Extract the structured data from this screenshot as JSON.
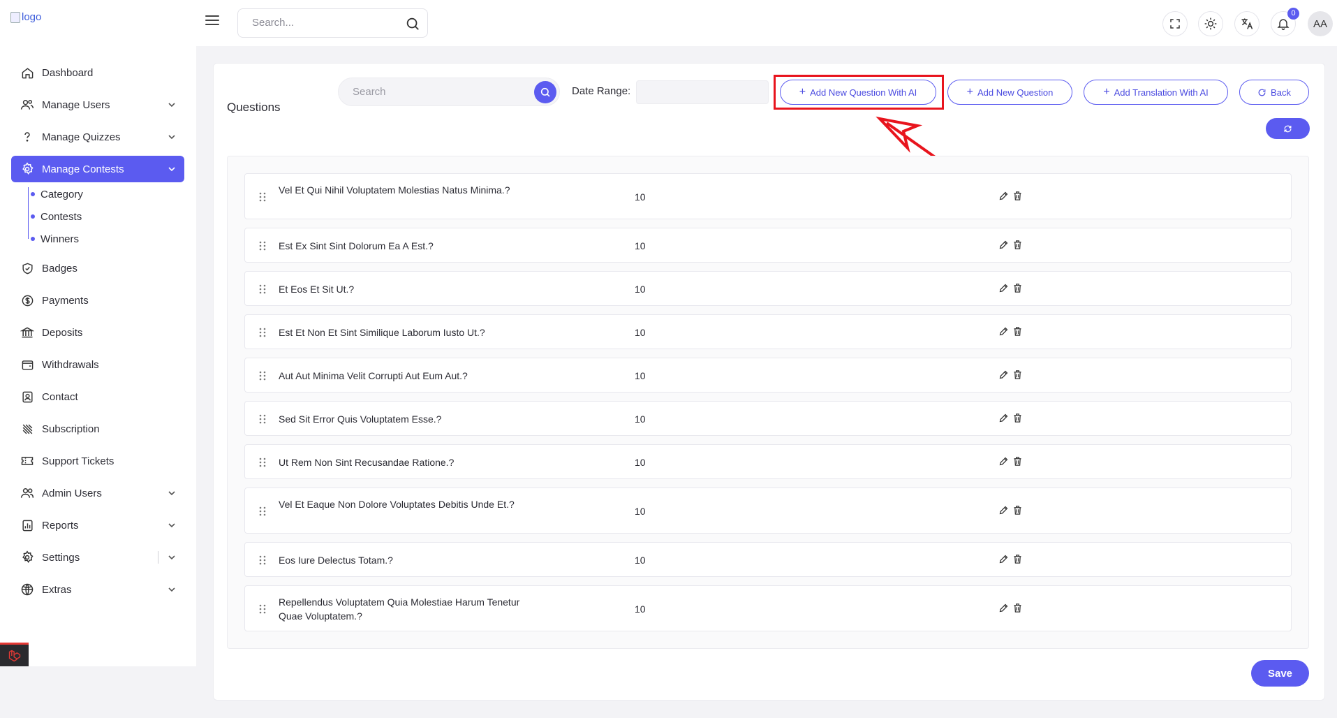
{
  "brand": {
    "logo_alt": "logo"
  },
  "header": {
    "search_placeholder": "Search...",
    "notification_count": "0",
    "avatar_initials": "AA",
    "icons": [
      "fullscreen-icon",
      "sun-icon",
      "translate-icon",
      "bell-icon"
    ]
  },
  "sidebar": {
    "items": [
      {
        "label": "Dashboard",
        "icon": "home-icon"
      },
      {
        "label": "Manage Users",
        "icon": "users-icon"
      },
      {
        "label": "Manage Quizzes",
        "icon": "question-icon"
      },
      {
        "label": "Manage Contests",
        "icon": "gear-icon"
      },
      {
        "label": "Badges",
        "icon": "shield-check-icon"
      },
      {
        "label": "Payments",
        "icon": "dollar-circle-icon"
      },
      {
        "label": "Deposits",
        "icon": "bank-icon"
      },
      {
        "label": "Withdrawals",
        "icon": "wallet-icon"
      },
      {
        "label": "Contact",
        "icon": "contact-icon"
      },
      {
        "label": "Subscription",
        "icon": "subscription-icon"
      },
      {
        "label": "Support Tickets",
        "icon": "ticket-icon"
      },
      {
        "label": "Admin Users",
        "icon": "admin-users-icon"
      },
      {
        "label": "Reports",
        "icon": "report-icon"
      },
      {
        "label": "Settings",
        "icon": "settings-icon"
      },
      {
        "label": "Extras",
        "icon": "globe-icon"
      }
    ],
    "sub_items": [
      "Category",
      "Contests",
      "Winners"
    ],
    "active": "Manage Contests"
  },
  "main": {
    "title": "Questions",
    "search_placeholder": "Search",
    "date_range_label": "Date Range:",
    "buttons": {
      "add_ai": "Add New Question With AI",
      "add_new": "Add New Question",
      "add_translation": "Add Translation With AI",
      "back": "Back",
      "save": "Save"
    },
    "questions": [
      {
        "text": "Vel Et Qui Nihil Voluptatem Molestias Natus Minima.?",
        "score": "10"
      },
      {
        "text": "Est Ex Sint Sint Dolorum Ea A Est.?",
        "score": "10"
      },
      {
        "text": "Et Eos Et Sit Ut.?",
        "score": "10"
      },
      {
        "text": "Est Et Non Et Sint Similique Laborum Iusto Ut.?",
        "score": "10"
      },
      {
        "text": "Aut Aut Minima Velit Corrupti Aut Eum Aut.?",
        "score": "10"
      },
      {
        "text": "Sed Sit Error Quis Voluptatem Esse.?",
        "score": "10"
      },
      {
        "text": "Ut Rem Non Sint Recusandae Ratione.?",
        "score": "10"
      },
      {
        "text": "Vel Et Eaque Non Dolore Voluptates Debitis Unde Et.?",
        "score": "10"
      },
      {
        "text": "Eos Iure Delectus Totam.?",
        "score": "10"
      },
      {
        "text": "Repellendus Voluptatem Quia Molestiae Harum Tenetur Quae Voluptatem.?",
        "score": "10"
      }
    ]
  },
  "colors": {
    "accent": "#5b5bf0",
    "highlight": "#e8141d",
    "background": "#f3f3f6"
  }
}
